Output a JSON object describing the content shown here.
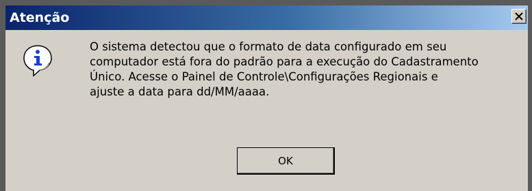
{
  "dialog": {
    "title": "Atenção",
    "close_label": "×",
    "icon": "info-icon",
    "message": "O sistema detectou que o formato de data configurado em seu\ncomputador está fora do padrão para a execução do Cadastramento\nÚnico. Acesse o Painel de Controle\\Configurações Regionais e\najuste a data para dd/MM/aaaa.",
    "ok_label": "OK"
  },
  "colors": {
    "title_gradient_start": "#0a246a",
    "title_gradient_end": "#a6caf0",
    "face": "#d4d0c8",
    "icon_blue": "#1c3fd0"
  }
}
